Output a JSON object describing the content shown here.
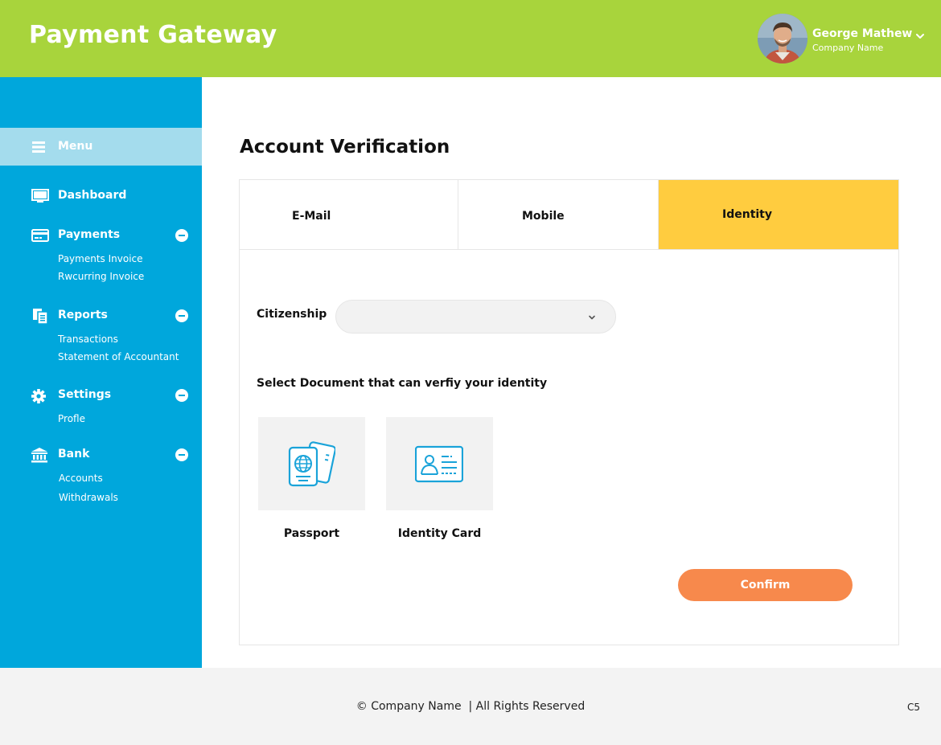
{
  "header": {
    "app_title": "Payment Gateway",
    "user": {
      "name": "George Mathew",
      "company": "Company Name"
    }
  },
  "sidebar": {
    "menu_label": "Menu",
    "items": [
      {
        "label": "Dashboard",
        "icon": "monitor-icon",
        "subitems": []
      },
      {
        "label": "Payments",
        "icon": "credit-card-icon",
        "expanded": true,
        "subitems": [
          "Payments Invoice",
          "Rwcurring Invoice"
        ]
      },
      {
        "label": "Reports",
        "icon": "documents-icon",
        "expanded": true,
        "subitems": [
          "Transactions",
          "Statement of Accountant"
        ]
      },
      {
        "label": "Settings",
        "icon": "gear-icon",
        "expanded": true,
        "subitems": [
          "Profle"
        ]
      },
      {
        "label": "Bank",
        "icon": "bank-icon",
        "expanded": true,
        "subitems": [
          "Accounts",
          "Withdrawals"
        ]
      }
    ]
  },
  "main": {
    "title": "Account Verification",
    "tabs": [
      {
        "label": "E-Mail",
        "active": false
      },
      {
        "label": "Mobile",
        "active": false
      },
      {
        "label": "Identity",
        "active": true
      }
    ],
    "citizenship": {
      "label": "Citizenship",
      "value": ""
    },
    "document_prompt": "Select Document that can verfiy your identity",
    "documents": [
      {
        "label": "Passport",
        "icon": "passport-icon"
      },
      {
        "label": "Identity Card",
        "icon": "id-card-icon"
      }
    ],
    "confirm_label": "Confirm"
  },
  "footer": {
    "copyright": "© Company Name  | All Rights Reserved",
    "code": "C5"
  },
  "colors": {
    "header_bg": "#a8d43c",
    "sidebar_bg": "#00a7dc",
    "menu_highlight": "#a4dced",
    "active_tab": "#ffcc3f",
    "confirm_button": "#f7894c",
    "footer_bg": "#f3f3f3"
  }
}
